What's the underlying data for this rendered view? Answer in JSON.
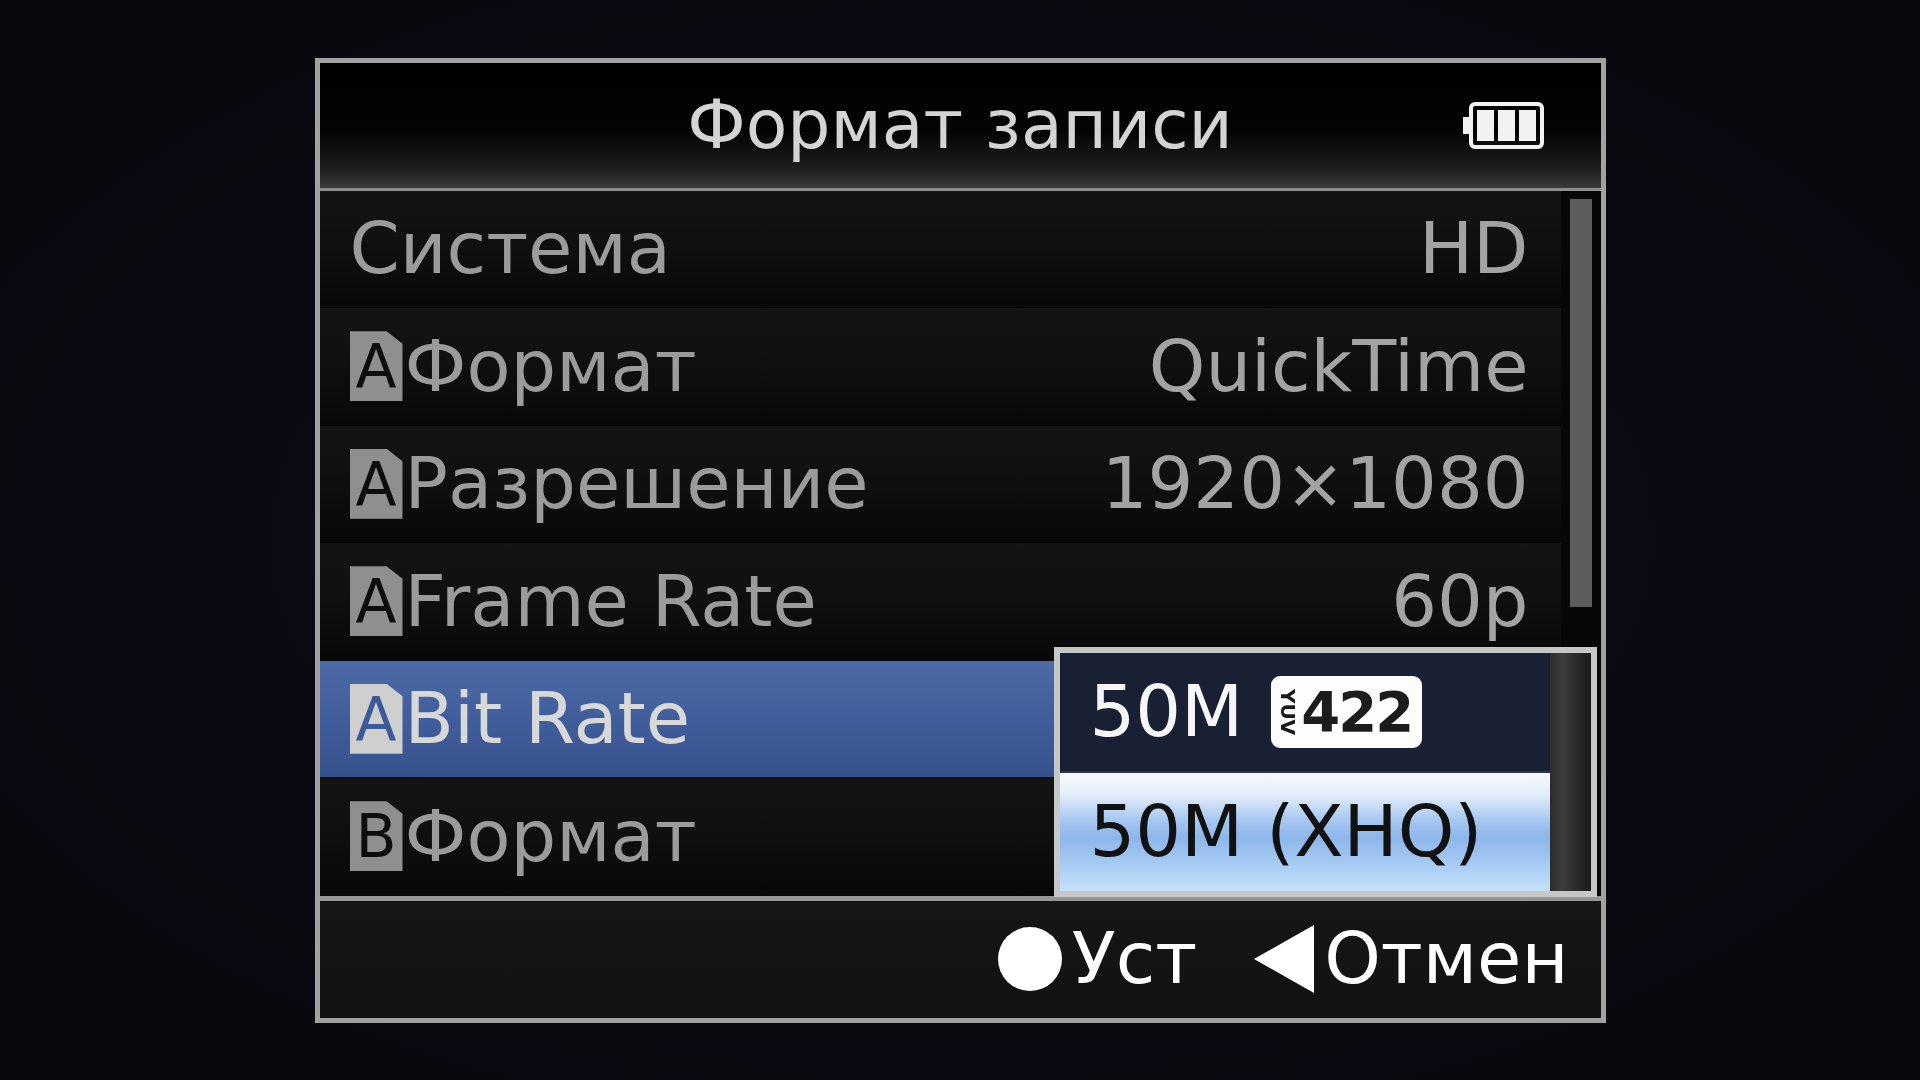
{
  "screen": {
    "title": "Формат записи"
  },
  "menu": {
    "rows": [
      {
        "label": "Система",
        "value": "HD",
        "selected": false
      },
      {
        "slot": "A",
        "label": "Формат",
        "value": "QuickTime",
        "selected": false
      },
      {
        "slot": "A",
        "label": "Разрешение",
        "value": "1920×1080",
        "selected": false
      },
      {
        "slot": "A",
        "label": "Frame Rate",
        "value": "60p",
        "selected": false
      },
      {
        "slot": "A",
        "label": "Bit Rate",
        "selected": true
      },
      {
        "slot": "B",
        "label": "Формат",
        "selected": false
      }
    ]
  },
  "popup": {
    "options": [
      {
        "label": "50M",
        "tag": {
          "caption": "YUV",
          "value": "422"
        },
        "selected": false
      },
      {
        "label": "50M (XHQ)",
        "selected": true
      }
    ]
  },
  "footer": {
    "hints": [
      {
        "kind": "circle",
        "label": "Уст"
      },
      {
        "kind": "triangle",
        "label": "Отмен"
      }
    ]
  }
}
